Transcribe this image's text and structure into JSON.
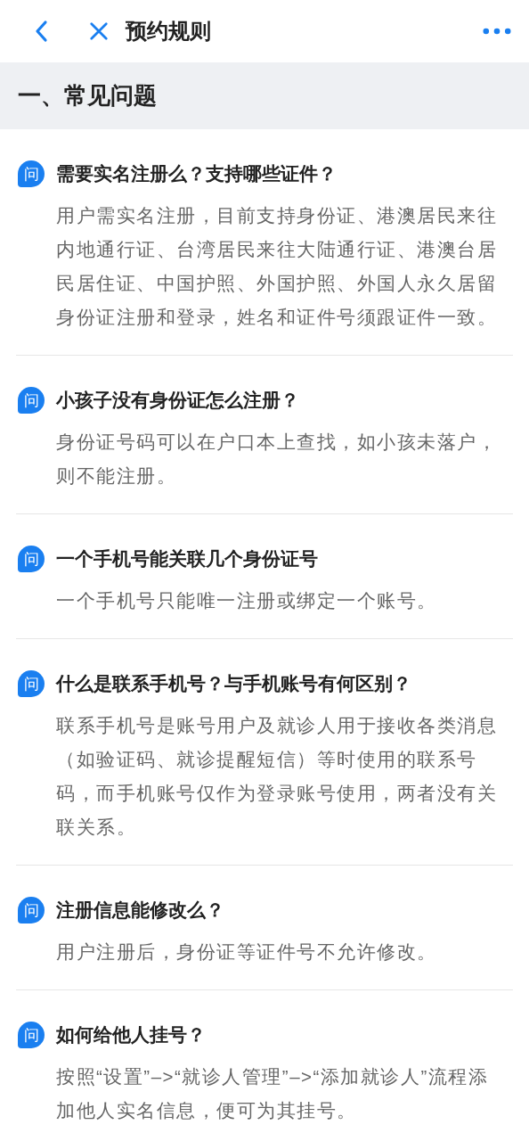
{
  "nav": {
    "title": "预约规则"
  },
  "section": {
    "title": "一、常见问题"
  },
  "faqs": [
    {
      "badge": "问",
      "question": "需要实名注册么？支持哪些证件？",
      "answer": "用户需实名注册，目前支持身份证、港澳居民来往内地通行证、台湾居民来往大陆通行证、港澳台居民居住证、中国护照、外国护照、外国人永久居留身份证注册和登录，姓名和证件号须跟证件一致。"
    },
    {
      "badge": "问",
      "question": "小孩子没有身份证怎么注册？",
      "answer": "身份证号码可以在户口本上查找，如小孩未落户，则不能注册。"
    },
    {
      "badge": "问",
      "question": "一个手机号能关联几个身份证号",
      "answer": "一个手机号只能唯一注册或绑定一个账号。"
    },
    {
      "badge": "问",
      "question": "什么是联系手机号？与手机账号有何区别？",
      "answer": "联系手机号是账号用户及就诊人用于接收各类消息（如验证码、就诊提醒短信）等时使用的联系号码，而手机账号仅作为登录账号使用，两者没有关联关系。"
    },
    {
      "badge": "问",
      "question": "注册信息能修改么？",
      "answer": "用户注册后，身份证等证件号不允许修改。"
    },
    {
      "badge": "问",
      "question": "如何给他人挂号？",
      "answer": "按照“设置”–>“就诊人管理”–>“添加就诊人”流程添加他人实名信息，便可为其挂号。"
    }
  ]
}
